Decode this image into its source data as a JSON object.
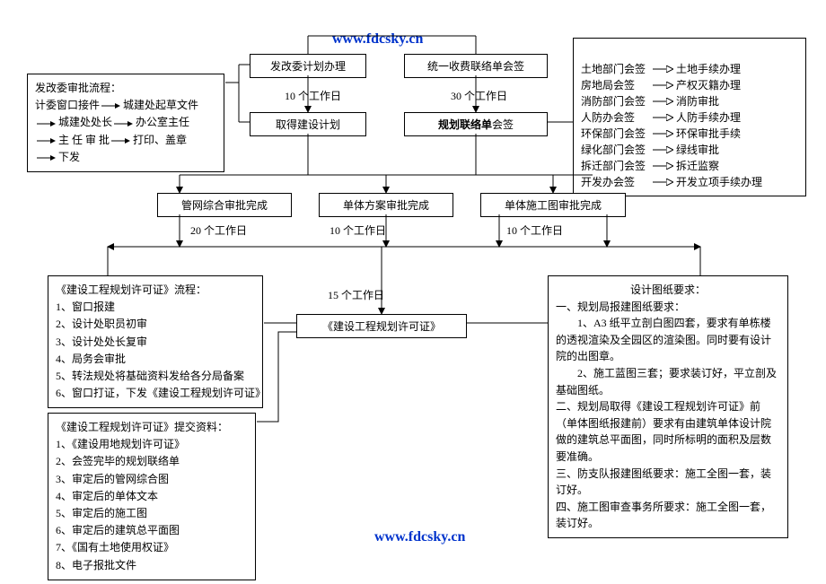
{
  "url": "www.fdcsky.cn",
  "top": {
    "plan": "发改委计划办理",
    "fee": "统一收费联络单会签",
    "d10": "10 个工作日",
    "d30": "30 个工作日",
    "getplan": "取得建设计划",
    "union": "规划联络单",
    "union_suffix": "会签"
  },
  "flow_panel": {
    "title": "发改委审批流程：",
    "s1a": "计委窗口接件",
    "s1b": "城建处起草文件",
    "s2a": "城建处处长",
    "s2b": "办公室主任",
    "s3a": "主 任  审 批",
    "s3b": "打印、盖章",
    "s4a": "下发"
  },
  "legend": [
    {
      "l": "土地部门会签",
      "r": "土地手续办理"
    },
    {
      "l": "房地局会签",
      "r": "产权灭籍办理"
    },
    {
      "l": "消防部门会签",
      "r": "消防审批"
    },
    {
      "l": "人防办会签",
      "r": "人防手续办理"
    },
    {
      "l": "环保部门会签",
      "r": "环保审批手续"
    },
    {
      "l": "绿化部门会签",
      "r": "绿线审批"
    },
    {
      "l": "拆迁部门会签",
      "r": "拆迁监察"
    },
    {
      "l": "开发办会签",
      "r": "开发立项手续办理"
    }
  ],
  "mid": {
    "b1": "管网综合审批完成",
    "b2": "单体方案审批完成",
    "b3": "单体施工图审批完成",
    "d20": "20 个工作日",
    "d10a": "10 个工作日",
    "d10b": "10 个工作日",
    "d15": "15 个工作日",
    "permit": "《建设工程规划许可证》"
  },
  "proc_panel": {
    "title": "《建设工程规划许可证》流程：",
    "items": [
      "窗口报建",
      "设计处职员初审",
      "设计处处长复审",
      "局务会审批",
      "转法规处将基础资料发给各分局备案",
      "窗口打证，下发《建设工程规划许可证》"
    ]
  },
  "submit_panel": {
    "title": "《建设工程规划许可证》提交资料：",
    "items": [
      "《建设用地规划许可证》",
      "会签完毕的规划联络单",
      "审定后的管网综合图",
      "审定后的单体文本",
      "审定后的施工图",
      "审定后的建筑总平面图",
      "《国有土地使用权证》",
      "电子报批文件"
    ]
  },
  "req_panel": {
    "title": "设计图纸要求：",
    "l1": "一、规划局报建图纸要求：",
    "l1a": "　　1、A3 纸平立剖白图四套，要求有单栋楼的透视渲染及全园区的渲染图。同时要有设计院的出图章。",
    "l1b": "　　2、施工蓝图三套；要求装订好，平立剖及基础图纸。",
    "l2": "二、规划局取得《建设工程规划许可证》前（单体图纸报建前）要求有由建筑单体设计院做的建筑总平面图，同时所标明的面积及层数要准确。",
    "l3": "三、防支队报建图纸要求：施工全图一套，装订好。",
    "l4": "四、施工图审查事务所要求：施工全图一套，装订好。"
  }
}
